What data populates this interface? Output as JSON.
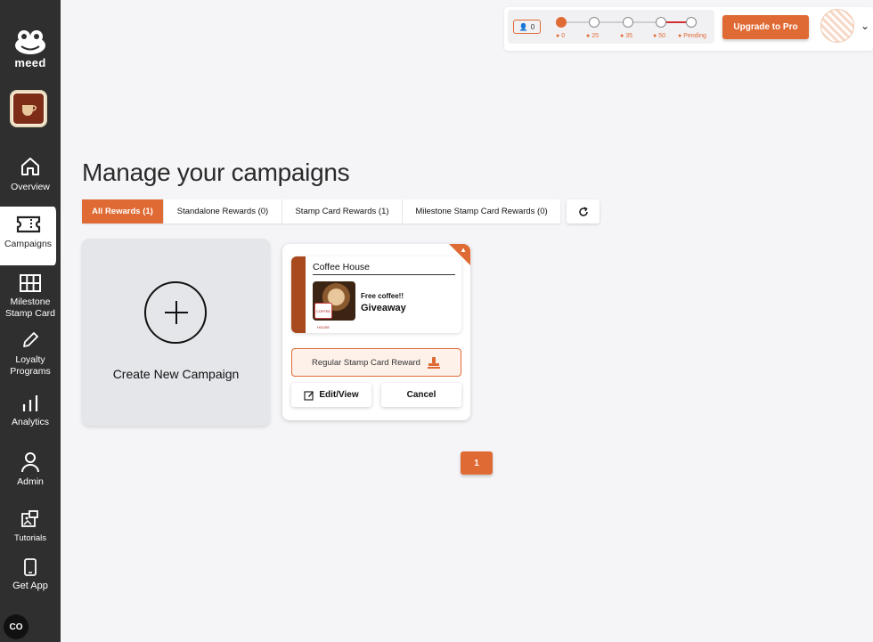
{
  "brand": {
    "name": "meed"
  },
  "sidebar": {
    "items": [
      {
        "label": "Overview",
        "icon": "home-icon"
      },
      {
        "label": "Campaigns",
        "icon": "ticket-icon",
        "active": true
      },
      {
        "label": "Milestone Stamp Card",
        "icon": "grid-icon"
      },
      {
        "label": "Loyalty Programs",
        "icon": "pencil-icon"
      },
      {
        "label": "Analytics",
        "icon": "bar-chart-icon"
      },
      {
        "label": "Admin",
        "icon": "user-icon"
      },
      {
        "label": "Tutorials",
        "icon": "tutorial-icon"
      },
      {
        "label": "Get App",
        "icon": "phone-icon"
      }
    ],
    "chat_label": "CO"
  },
  "topbar": {
    "member_count": "0",
    "tiers": [
      "0",
      "25",
      "35",
      "50",
      "Pending"
    ],
    "upgrade_label": "Upgrade to Pro"
  },
  "main": {
    "title": "Manage your campaigns",
    "tabs": [
      {
        "label": "All Rewards (1)",
        "active": true
      },
      {
        "label": "Standalone Rewards (0)"
      },
      {
        "label": "Stamp Card Rewards (1)"
      },
      {
        "label": "Milestone Stamp Card Rewards (0)"
      }
    ],
    "create_label": "Create New Campaign",
    "campaign": {
      "business": "Coffee House",
      "reward_title": "Free coffee!!",
      "reward_type_short": "Giveaway",
      "reward_type": "Regular Stamp Card Reward",
      "logo_text": "COFFEE HOUSE",
      "edit_label": "Edit/View",
      "cancel_label": "Cancel"
    },
    "pagination": {
      "current": "1"
    }
  },
  "colors": {
    "accent": "#e06a34",
    "sidebar": "#2f2f2f",
    "page_bg": "#f5f5f8"
  }
}
